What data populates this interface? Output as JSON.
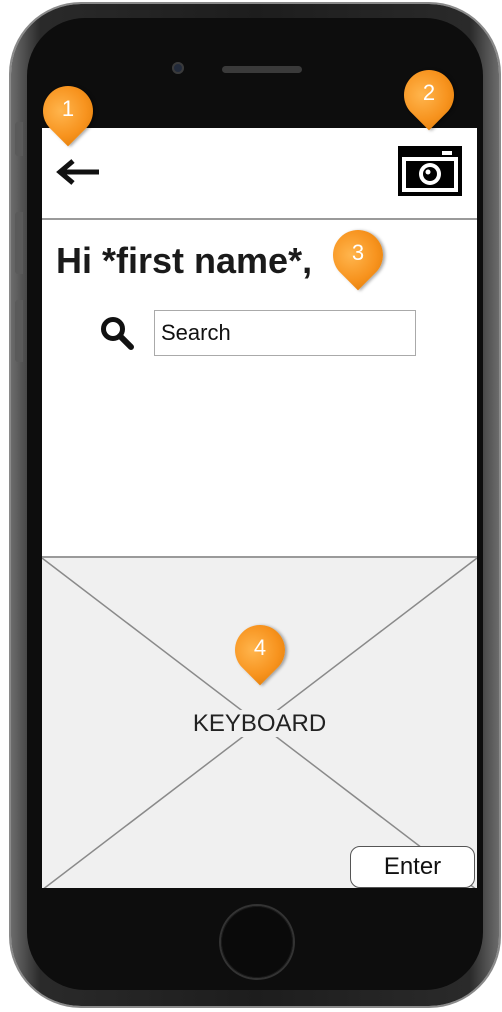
{
  "header": {
    "back_icon": "arrow-left-icon",
    "camera_icon": "camera-icon"
  },
  "greeting": "Hi *first name*,",
  "search": {
    "icon": "search-icon",
    "value": "Search"
  },
  "keyboard": {
    "label": "KEYBOARD",
    "enter_label": "Enter"
  },
  "annotations": [
    "1",
    "2",
    "3",
    "4"
  ],
  "colors": {
    "marker": "#f7931e",
    "placeholder_bg": "#f0f0f0",
    "phone_frame": "#1d1d1d"
  }
}
